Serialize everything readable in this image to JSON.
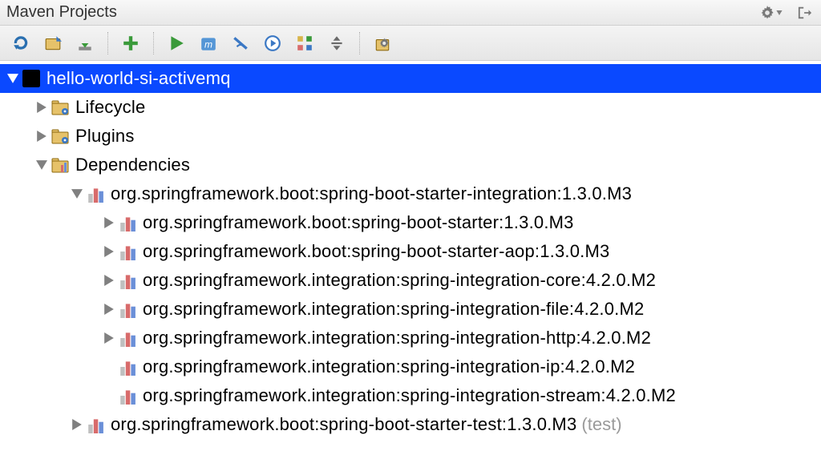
{
  "titlebar": {
    "title": "Maven Projects"
  },
  "toolbar": {
    "refresh": "refresh",
    "generate_sources": "generate-sources",
    "download": "download",
    "add": "add",
    "run": "run",
    "run_maven": "run-maven",
    "toggle_offline": "toggle-offline",
    "execute_goal": "execute-goal",
    "dependency_graph": "dependency-graph",
    "collapse_all": "collapse-all",
    "settings": "settings"
  },
  "tree": {
    "root": {
      "label": "hello-world-si-activemq",
      "children": [
        {
          "label": "Lifecycle",
          "type": "lifecycle"
        },
        {
          "label": "Plugins",
          "type": "plugins"
        },
        {
          "label": "Dependencies",
          "type": "dependencies",
          "children": [
            {
              "label": "org.springframework.boot:spring-boot-starter-integration:1.3.0.M3",
              "children": [
                {
                  "label": "org.springframework.boot:spring-boot-starter:1.3.0.M3"
                },
                {
                  "label": "org.springframework.boot:spring-boot-starter-aop:1.3.0.M3"
                },
                {
                  "label": "org.springframework.integration:spring-integration-core:4.2.0.M2"
                },
                {
                  "label": "org.springframework.integration:spring-integration-file:4.2.0.M2"
                },
                {
                  "label": "org.springframework.integration:spring-integration-http:4.2.0.M2"
                },
                {
                  "label": "org.springframework.integration:spring-integration-ip:4.2.0.M2",
                  "leaf": true
                },
                {
                  "label": "org.springframework.integration:spring-integration-stream:4.2.0.M2",
                  "leaf": true
                }
              ]
            },
            {
              "label": "org.springframework.boot:spring-boot-starter-test:1.3.0.M3",
              "scope": "(test)"
            }
          ]
        }
      ]
    }
  }
}
